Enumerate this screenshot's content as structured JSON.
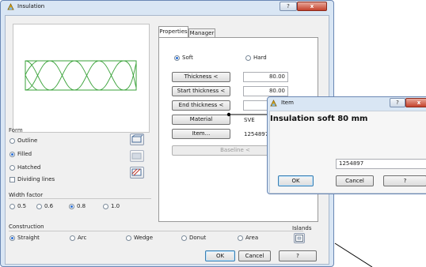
{
  "main_window": {
    "title": "Insulation",
    "help_glyph": "?",
    "close_glyph": "x"
  },
  "tabs": {
    "properties": "Properties",
    "manager": "Manager"
  },
  "properties": {
    "soft_label": "Soft",
    "hard_label": "Hard",
    "thickness_button": "Thickness <",
    "thickness_value": "80.00",
    "start_thickness_button": "Start thickness <",
    "start_thickness_value": "80.00",
    "end_thickness_button": "End thickness <",
    "material_button": "Material",
    "material_value": "SVE",
    "item_button": "Item...",
    "item_value": "1254897",
    "baseline_button": "Baseline <"
  },
  "form": {
    "header": "Form",
    "outline": "Outline",
    "filled": "Filled",
    "hatched": "Hatched",
    "dividing_lines": "Dividing lines"
  },
  "width_factor": {
    "header": "Width factor",
    "options": [
      "0.5",
      "0.6",
      "0.8",
      "1.0"
    ],
    "selected_index": 2
  },
  "construction": {
    "header": "Construction",
    "straight": "Straight",
    "arc": "Arc",
    "wedge": "Wedge",
    "donut": "Donut",
    "area": "Area",
    "islands": "Islands"
  },
  "footer": {
    "ok": "OK",
    "cancel": "Cancel",
    "help": "?"
  },
  "item_dialog": {
    "title": "Item",
    "heading": "Insulation soft 80 mm",
    "input_value": "1254897",
    "ok": "OK",
    "cancel": "Cancel",
    "help": "?",
    "help_glyph": "?",
    "close_glyph": "x"
  },
  "colors": {
    "insulation_pattern": "#3aa23a",
    "title_bar": "#d9e6f4"
  },
  "icons": {
    "app": "insulation-app-icon",
    "outline_form": "outline-form-icon",
    "filled_form": "filled-form-icon",
    "hatched_form": "hatched-form-icon",
    "islands": "islands-icon"
  }
}
